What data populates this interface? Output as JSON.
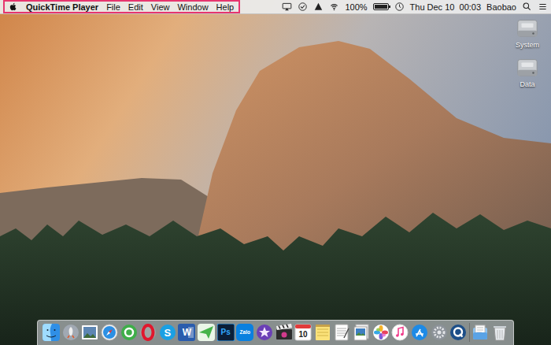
{
  "menu_bar": {
    "app_name": "QuickTime Player",
    "menus": [
      "File",
      "Edit",
      "View",
      "Window",
      "Help"
    ],
    "highlighted": true,
    "battery": {
      "reading": "100%",
      "level": 1
    },
    "clock": "Thu Dec 10  00:03",
    "user": "Baobao"
  },
  "desktop_icons": [
    {
      "label": "System"
    },
    {
      "label": "Data"
    }
  ],
  "dock": {
    "apps": [
      {
        "kind": "finder"
      },
      {
        "kind": "launchpad"
      },
      {
        "kind": "photo"
      },
      {
        "kind": "safari"
      },
      {
        "kind": "coccoc"
      },
      {
        "kind": "opera"
      },
      {
        "kind": "skype",
        "text": "S"
      },
      {
        "kind": "word",
        "text": "W"
      },
      {
        "kind": "sender"
      },
      {
        "kind": "photoshop",
        "text": "Ps"
      },
      {
        "kind": "zalo",
        "text": "Zalo"
      },
      {
        "kind": "imovie"
      },
      {
        "kind": "finalcut"
      },
      {
        "kind": "calendar",
        "text": "10"
      },
      {
        "kind": "notes"
      },
      {
        "kind": "textedit"
      },
      {
        "kind": "preview"
      },
      {
        "kind": "photos"
      },
      {
        "kind": "itunes"
      },
      {
        "kind": "appstore"
      },
      {
        "kind": "sysprefs"
      },
      {
        "kind": "quicktime"
      }
    ],
    "others": [
      {
        "kind": "documents"
      },
      {
        "kind": "trash"
      }
    ]
  }
}
